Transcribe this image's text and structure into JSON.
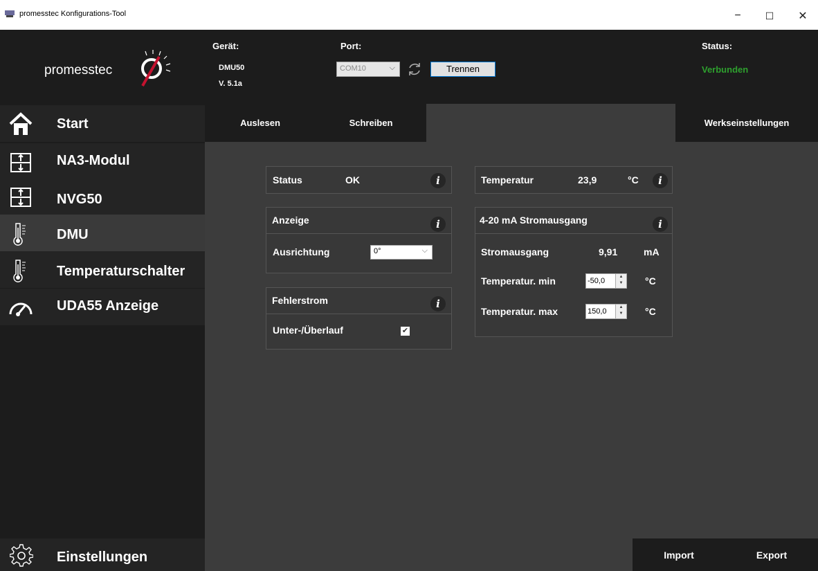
{
  "window": {
    "title": "promesstec Konfigurations-Tool",
    "minimize": "−",
    "maximize": "☐",
    "close": "✕"
  },
  "header": {
    "logo": "promesstec",
    "device_label": "Gerät:",
    "device_name": "DMU50",
    "device_version": "V. 5.1a",
    "port_label": "Port:",
    "port_value": "COM10",
    "disconnect_label": "Trennen",
    "status_label": "Status:",
    "status_value": "Verbunden",
    "status_color": "#2ea02e"
  },
  "sidebar": {
    "items": [
      {
        "label": "Start",
        "icon": "home-icon"
      },
      {
        "label": "NA3-Modul",
        "icon": "module-icon"
      },
      {
        "label": "NVG50",
        "icon": "module-icon"
      },
      {
        "label": "DMU",
        "icon": "thermometer-icon"
      },
      {
        "label": "Temperaturschalter",
        "icon": "thermometer-icon"
      },
      {
        "label": "UDA55 Anzeige",
        "icon": "gauge-icon"
      }
    ],
    "active": "DMU",
    "settings_label": "Einstellungen"
  },
  "toolbar": {
    "read": "Auslesen",
    "write": "Schreiben",
    "factory": "Werkseinstellungen"
  },
  "panels": {
    "status": {
      "label": "Status",
      "value": "OK"
    },
    "display": {
      "title": "Anzeige",
      "orientation_label": "Ausrichtung",
      "orientation_value": "0°"
    },
    "fault": {
      "title": "Fehlerstrom",
      "overflow_label": "Unter-/Überlauf",
      "overflow_checked": true
    },
    "temperature": {
      "label": "Temperatur",
      "value": "23,9",
      "unit": "°C"
    },
    "current": {
      "title": "4-20 mA Stromausgang",
      "output_label": "Stromausgang",
      "output_value": "9,91",
      "output_unit": "mA",
      "tmin_label": "Temperatur. min",
      "tmin_value": "-50,0",
      "tmax_label": "Temperatur. max",
      "tmax_value": "150,0",
      "temp_unit": "°C"
    }
  },
  "footer": {
    "import": "Import",
    "export": "Export"
  }
}
